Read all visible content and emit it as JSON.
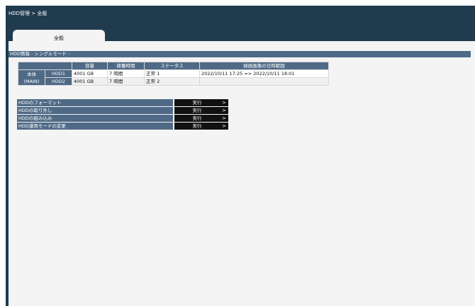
{
  "header": {
    "breadcrumb": "HDD管理 > 全般"
  },
  "tabs": [
    {
      "label": "全般"
    }
  ],
  "hdd_info": {
    "section_title": "HDD情報 - シングルモード -",
    "columns": [
      "容量",
      "稼働時間",
      "ステータス",
      "録画画像の日時範囲"
    ],
    "main_label_line1": "本体",
    "main_label_line2": "(MAIN)",
    "rows": [
      {
        "name": "HDD1",
        "capacity": "4001 GB",
        "uptime": "7 時間",
        "status": "正常 1",
        "range": "2022/10/11 17:25 => 2022/10/11 18:01"
      },
      {
        "name": "HDD2",
        "capacity": "4001 GB",
        "uptime": "7 時間",
        "status": "正常 2",
        "range": ""
      }
    ]
  },
  "actions": [
    {
      "label": "HDDのフォーマット",
      "button": "実行",
      "arrow": ">"
    },
    {
      "label": "HDDの取り外し",
      "button": "実行",
      "arrow": ">"
    },
    {
      "label": "HDDの組み込み",
      "button": "実行",
      "arrow": ">"
    },
    {
      "label": "HDD運用モードの変更",
      "button": "実行",
      "arrow": ">"
    }
  ]
}
